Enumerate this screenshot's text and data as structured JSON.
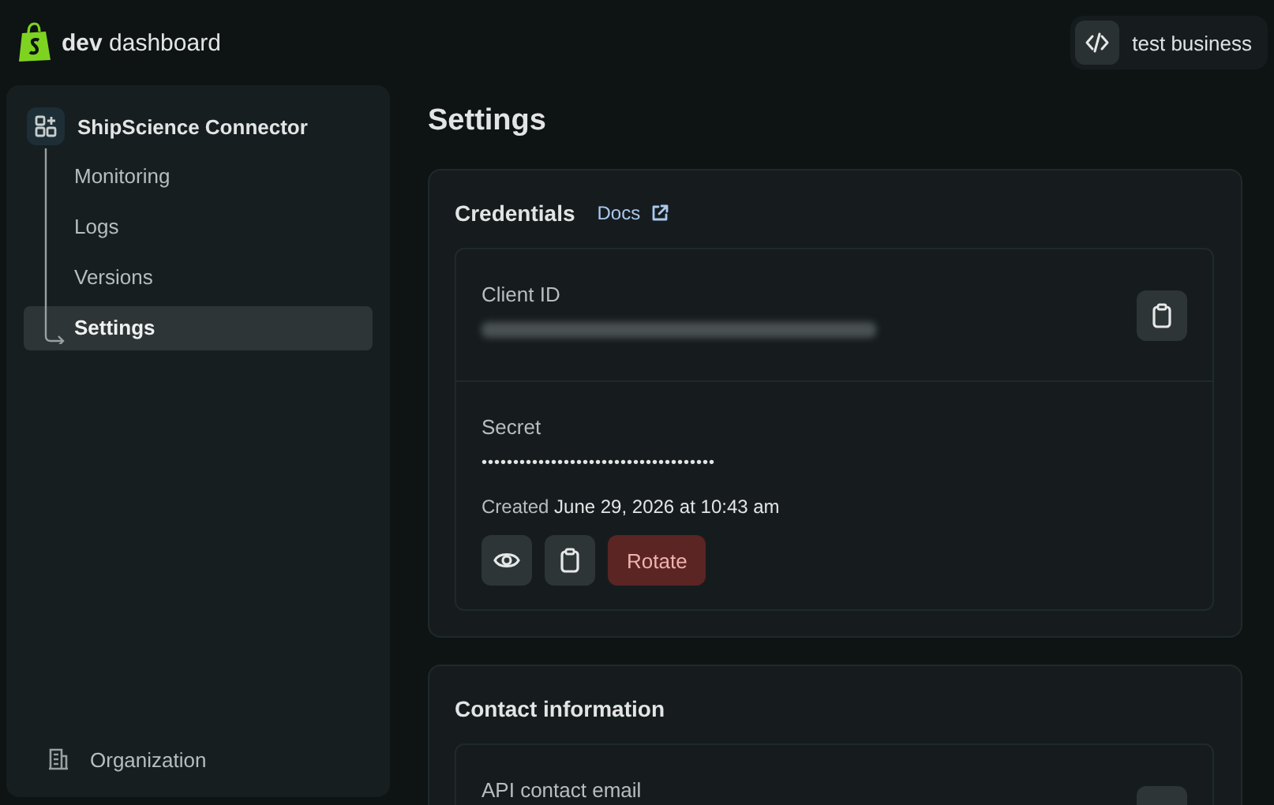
{
  "header": {
    "logo_bold": "dev",
    "logo_text": "dashboard",
    "account": "test business"
  },
  "sidebar": {
    "app": {
      "name": "ShipScience Connector",
      "children": [
        {
          "label": "Monitoring",
          "selected": false
        },
        {
          "label": "Logs",
          "selected": false
        },
        {
          "label": "Versions",
          "selected": false
        },
        {
          "label": "Settings",
          "selected": true
        }
      ]
    },
    "footer": {
      "label": "Organization"
    }
  },
  "page": {
    "title": "Settings"
  },
  "credentials": {
    "title": "Credentials",
    "docs_link": "Docs",
    "client_id": {
      "label": "Client ID"
    },
    "secret": {
      "label": "Secret",
      "masked": "•••••••••••••••••••••••••••••••••••••",
      "created_label": "Created",
      "created_value": "June 29, 2026 at 10:43 am"
    },
    "rotate_button": "Rotate"
  },
  "contact": {
    "title": "Contact information",
    "field_label": "API contact email"
  }
}
